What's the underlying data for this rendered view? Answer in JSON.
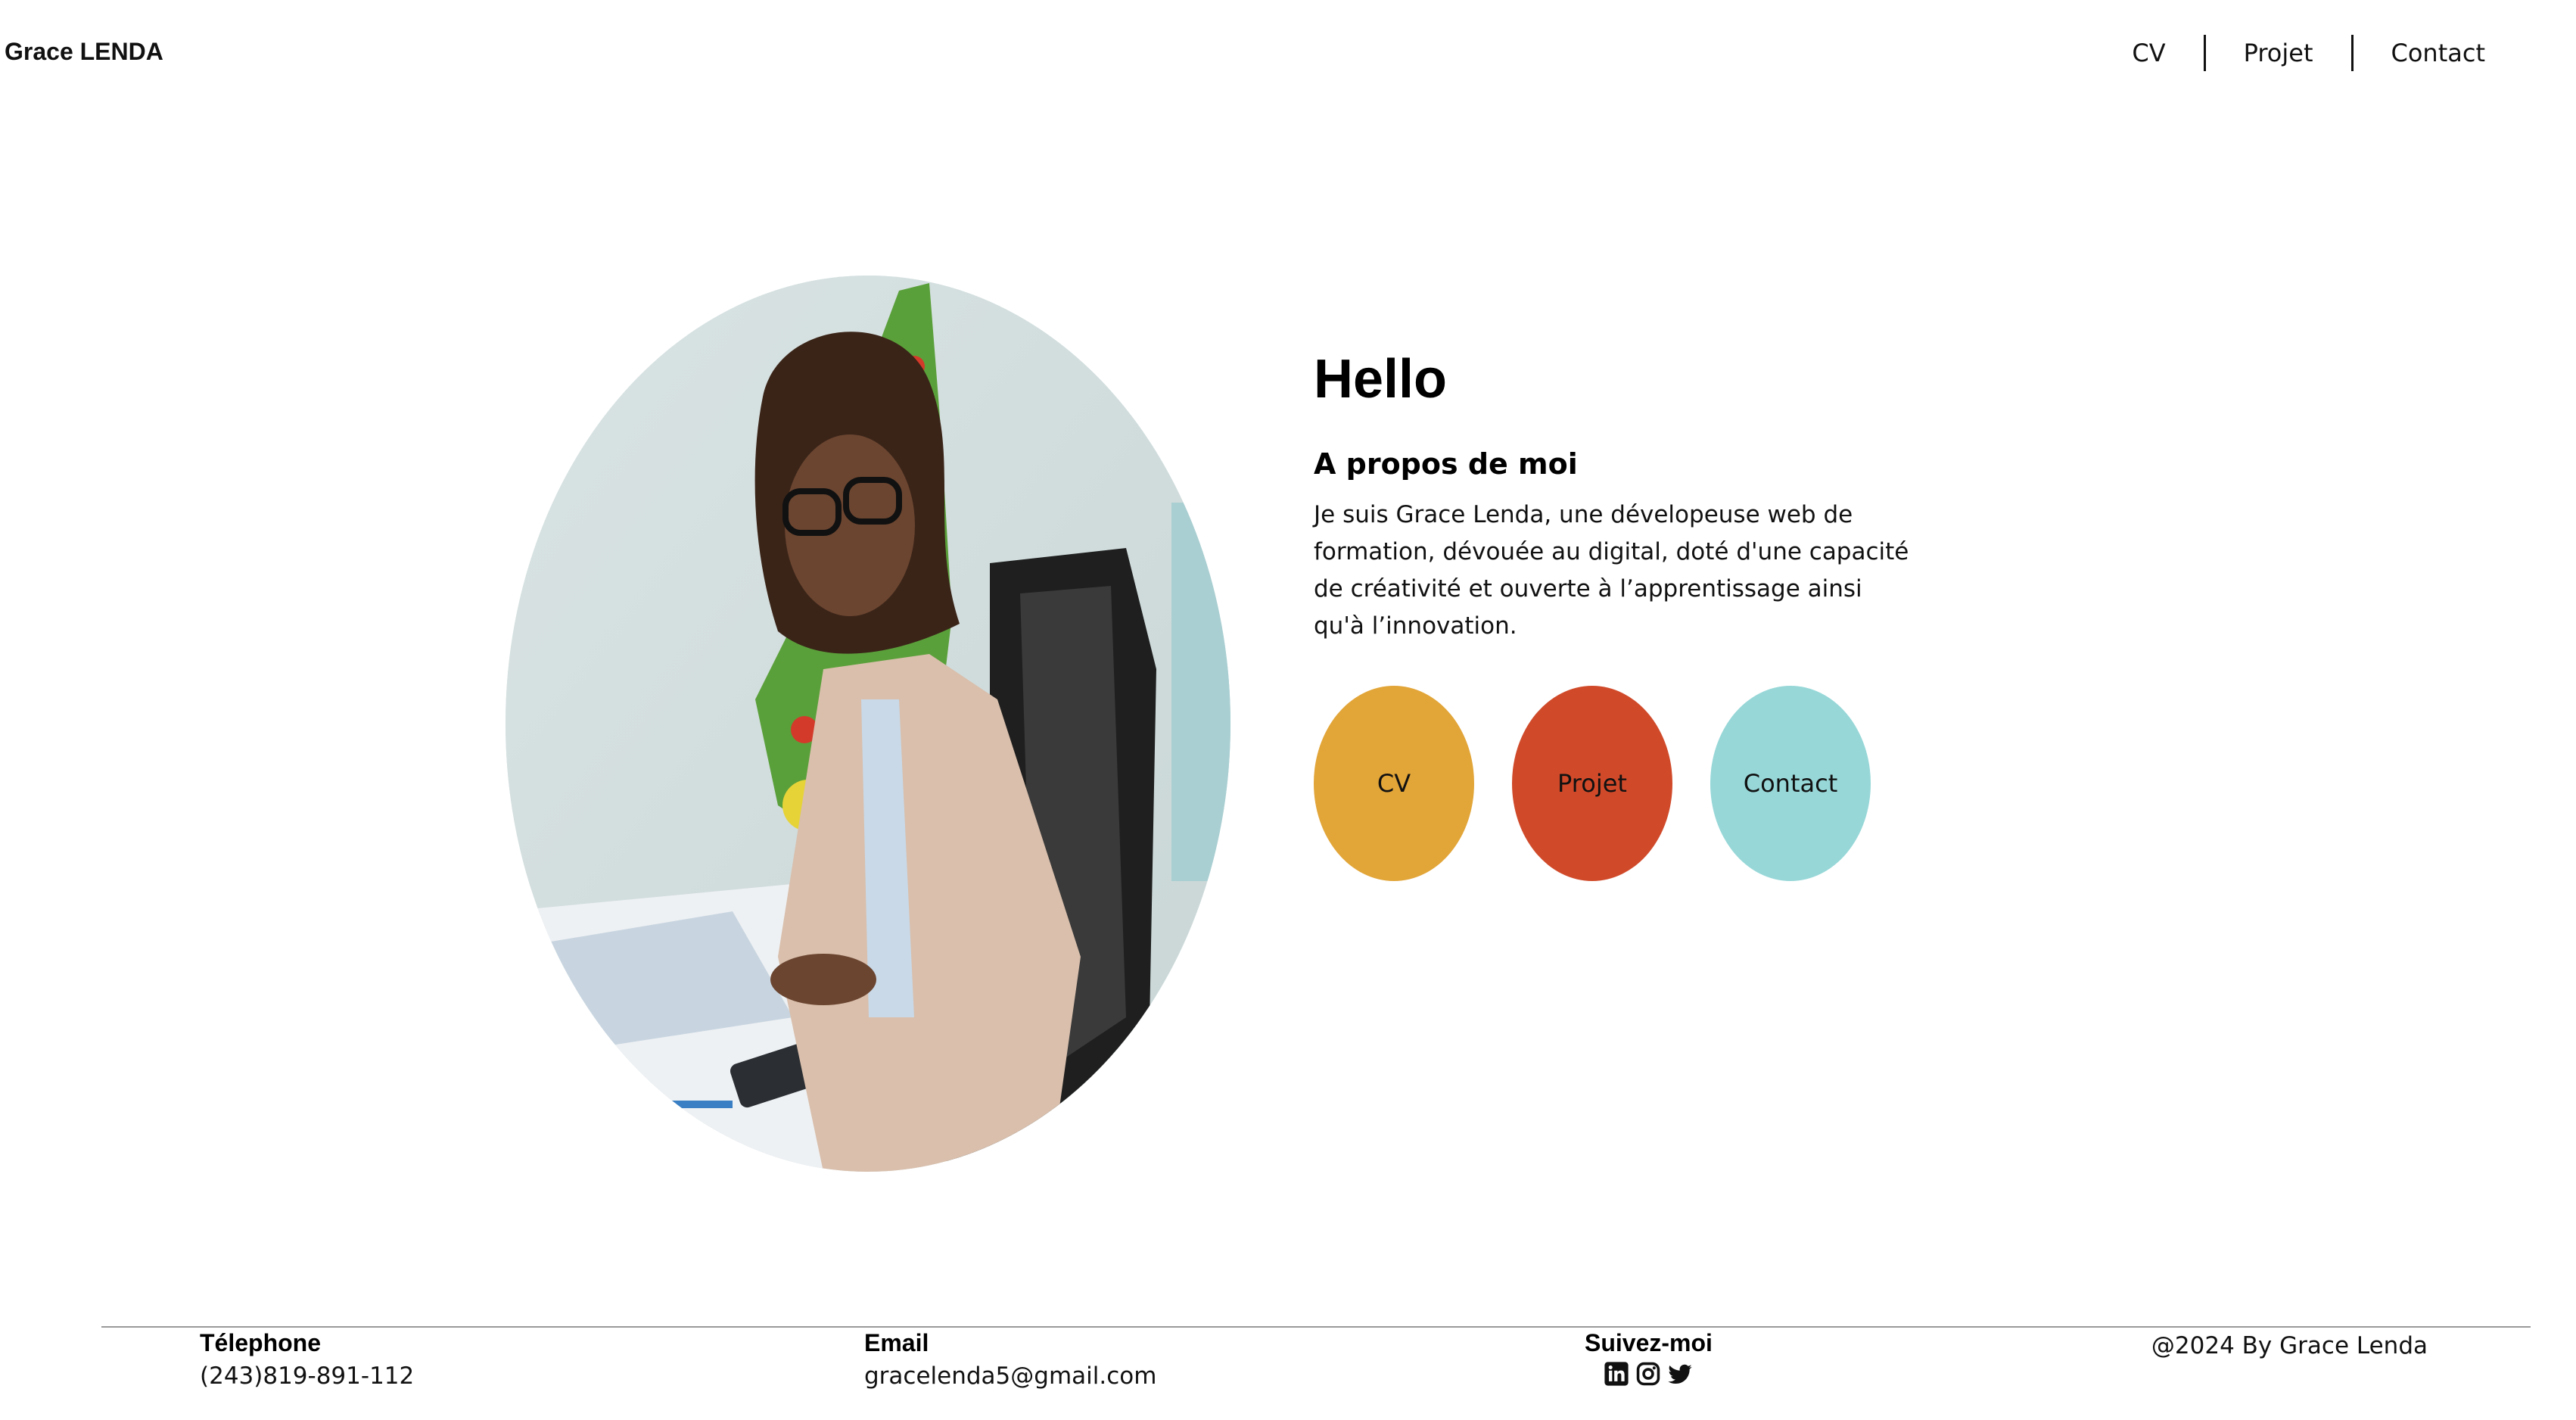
{
  "header": {
    "brand": "Grace LENDA",
    "nav": [
      "CV",
      "Projet",
      "Contact"
    ]
  },
  "intro": {
    "greeting": "Hello",
    "about_title": "A propos de moi",
    "about_text": "Je suis Grace Lenda, une dévelopeuse web de formation, dévouée au digital, doté d'une capacité de créativité et ouverte à l’apprentissage ainsi qu'à l’innovation."
  },
  "buttons": [
    {
      "label": "CV",
      "color": "#E2A538"
    },
    {
      "label": "Projet",
      "color": "#D04A2A"
    },
    {
      "label": "Contact",
      "color": "#97D7D8"
    }
  ],
  "footer": {
    "phone_label": "Télephone",
    "phone_value": "(243)819-891-112",
    "email_label": "Email",
    "email_value": "gracelenda5@gmail.com",
    "social_label": "Suivez-moi",
    "social_icons": [
      "linkedin-icon",
      "instagram-icon",
      "twitter-icon"
    ],
    "copyright": "@2024 By Grace Lenda"
  }
}
